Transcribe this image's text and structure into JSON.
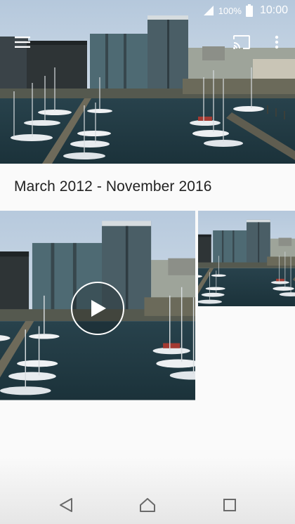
{
  "status_bar": {
    "signal_icon": "signal-icon",
    "battery_percent": "100%",
    "battery_icon": "battery-icon",
    "time": "10:00"
  },
  "toolbar": {
    "menu_icon": "menu-icon",
    "cast_icon": "cast-icon",
    "more_icon": "more-vertical-icon"
  },
  "album": {
    "date_range": "March 2012 - November 2016",
    "items": [
      {
        "type": "video",
        "overlay_icon": "play-icon"
      },
      {
        "type": "photo"
      }
    ]
  },
  "nav_bar": {
    "back_icon": "back-icon",
    "home_icon": "home-icon",
    "recents_icon": "recents-icon"
  }
}
